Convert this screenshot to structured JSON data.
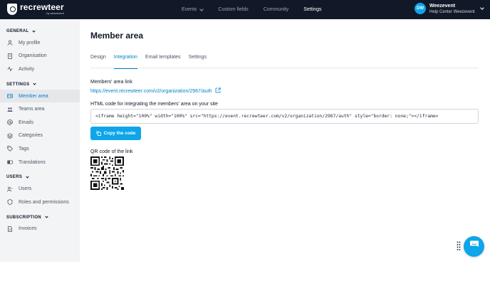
{
  "brand": {
    "name": "recrewteer",
    "sub": "by weezevent"
  },
  "topnav": {
    "items": [
      {
        "label": "Events",
        "has_dropdown": true,
        "active": false
      },
      {
        "label": "Custom fields",
        "has_dropdown": false,
        "active": false
      },
      {
        "label": "Community",
        "has_dropdown": false,
        "active": false
      },
      {
        "label": "Settings",
        "has_dropdown": false,
        "active": true
      }
    ]
  },
  "user": {
    "initials": "DW",
    "name": "Weezevent",
    "org": "Help Center Weezevent"
  },
  "sidebar": {
    "sections": [
      {
        "title": "GENERAL",
        "items": [
          {
            "label": "My profile",
            "icon": "user-icon",
            "active": false
          },
          {
            "label": "Organisation",
            "icon": "building-icon",
            "active": false
          },
          {
            "label": "Activity",
            "icon": "activity-icon",
            "active": false
          }
        ]
      },
      {
        "title": "SETTINGS",
        "items": [
          {
            "label": "Member area",
            "icon": "id-card-icon",
            "active": true
          },
          {
            "label": "Teams area",
            "icon": "team-icon",
            "active": false
          },
          {
            "label": "Emails",
            "icon": "at-sign-icon",
            "active": false
          },
          {
            "label": "Categories",
            "icon": "layers-icon",
            "active": false
          },
          {
            "label": "Tags",
            "icon": "tag-icon",
            "active": false
          },
          {
            "label": "Translations",
            "icon": "translate-icon",
            "active": false
          }
        ]
      },
      {
        "title": "USERS",
        "items": [
          {
            "label": "Users",
            "icon": "users-icon",
            "active": false
          },
          {
            "label": "Roles and permissions",
            "icon": "shield-icon",
            "active": false
          }
        ]
      },
      {
        "title": "SUBSCRIPTION",
        "items": [
          {
            "label": "Invoices",
            "icon": "file-icon",
            "active": false
          }
        ]
      }
    ]
  },
  "main": {
    "title": "Member area",
    "tabs": [
      {
        "label": "Design",
        "active": false
      },
      {
        "label": "Integration",
        "active": true
      },
      {
        "label": "Email templates",
        "active": false
      },
      {
        "label": "Settings",
        "active": false
      }
    ],
    "members_link_label": "Members' area link",
    "members_link_url": "https://event.recrewteer.com/v2/organization/2967/auth",
    "html_code_label": "HTML code for integrating the members' area on your site",
    "html_code": "<iframe height=\"100%\" width=\"100%\" src=\"https://event.recrewteer.com/v2/organization/2967/auth\" style=\"border: none;\"></iframe>",
    "copy_button_label": "Copy the code",
    "qr_label": "QR code of the link"
  },
  "colors": {
    "accent": "#0ea5e9",
    "link": "#0284c7",
    "topbar": "#111827",
    "sidebar": "#f3f4f6"
  }
}
